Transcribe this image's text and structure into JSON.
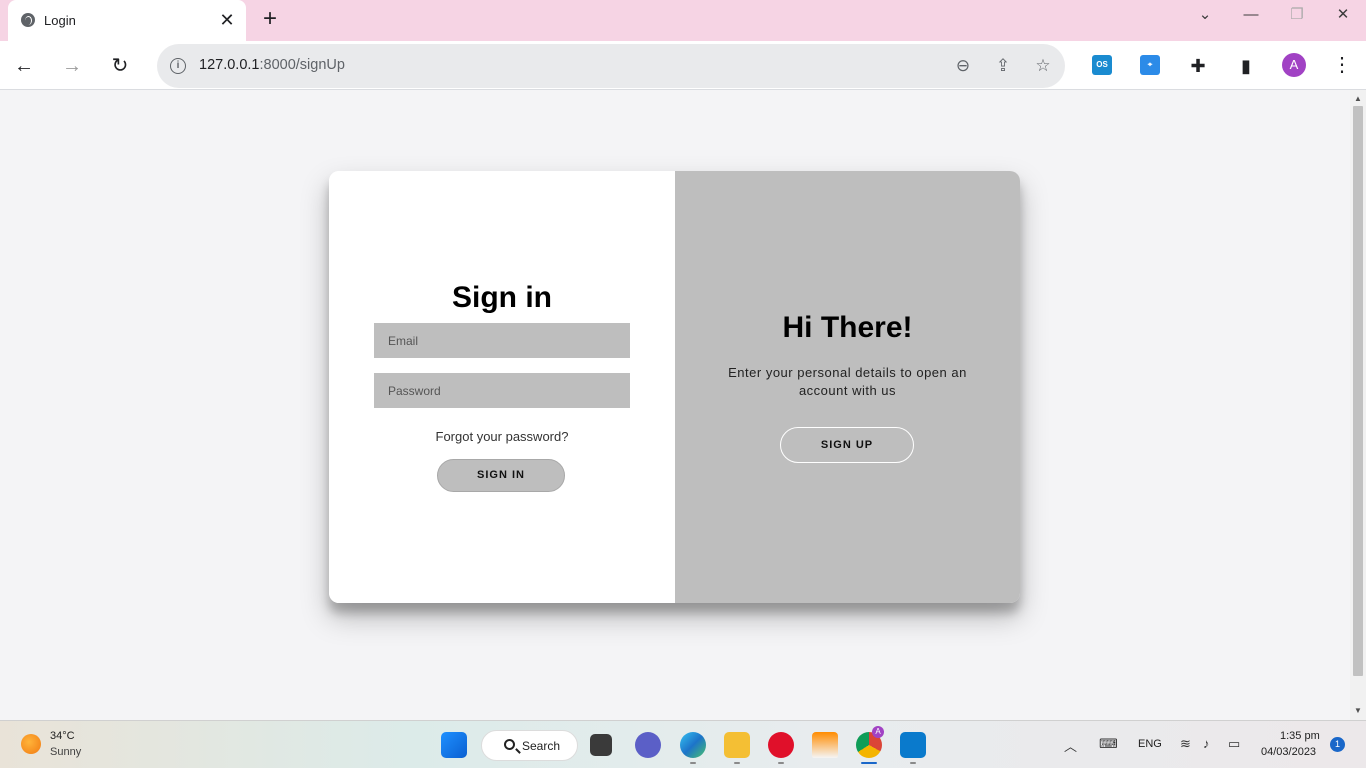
{
  "browser": {
    "tab_title": "Login",
    "tab_close": "✕",
    "new_tab": "+",
    "url_host": "127.0.0.1",
    "url_path": ":8000/signUp",
    "avatar_letter": "A",
    "extensions": [
      {
        "name": "osint-extension",
        "label": "OS",
        "color": "#1a8bd0"
      },
      {
        "name": "pin-extension",
        "label": "",
        "color": "#2c8be8"
      }
    ]
  },
  "signin": {
    "title": "Sign in",
    "email_placeholder": "Email",
    "password_placeholder": "Password",
    "forgot": "Forgot your password?",
    "button": "SIGN IN"
  },
  "overlay": {
    "title": "Hi There!",
    "text": "Enter your personal details to open an account with us",
    "button": "SIGN UP"
  },
  "taskbar": {
    "weather_temp": "34°C",
    "weather_cond": "Sunny",
    "search_label": "Search",
    "lang": "ENG",
    "time": "1:35 pm",
    "date": "04/03/2023",
    "notifications": "1",
    "chrome_badge": "A"
  }
}
